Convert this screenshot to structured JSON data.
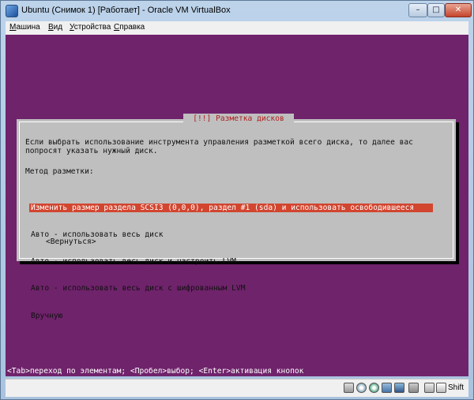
{
  "window": {
    "title": "Ubuntu (Снимок 1) [Работает] - Oracle VM VirtualBox",
    "minimize_glyph": "–",
    "maximize_glyph": "□",
    "close_glyph": "✕"
  },
  "menu": [
    {
      "label": "Машина"
    },
    {
      "label": "Вид"
    },
    {
      "label": "Устройства"
    },
    {
      "label": "Справка"
    }
  ],
  "dialog": {
    "title": "[!!] Разметка дисков",
    "description": "Если выбрать использование инструмента управления разметкой всего диска, то далее вас\nпопросят указать нужный диск.",
    "method_label": "Метод разметки:",
    "options": [
      {
        "label": "Изменить размер раздела SCSI3 (0,0,0), раздел #1 (sda) и использовать освободившееся",
        "selected": true
      },
      {
        "label": "Авто - использовать весь диск",
        "selected": false
      },
      {
        "label": "Авто - использовать весь диск и настроить LVM",
        "selected": false
      },
      {
        "label": "Авто - использовать весь диск с шифрованным LVM",
        "selected": false
      },
      {
        "label": "Вручную",
        "selected": false
      }
    ],
    "back_button": "<Вернуться>"
  },
  "installer_status": "<Tab>переход по элементам; <Пробел>выбор; <Enter>активация кнопок",
  "statusbar": {
    "icons": [
      "hard-disk-icon",
      "cd-drive-icon",
      "usb-icon",
      "network-icon",
      "shared-folder-icon",
      "display-icon",
      "mouse-integration-icon"
    ],
    "host_key": "Shift",
    "colors": {
      "screen": "#6f236b",
      "dialog": "#bfbfbf",
      "selection": "#d2452f",
      "dialog_title": "#b02020"
    }
  }
}
